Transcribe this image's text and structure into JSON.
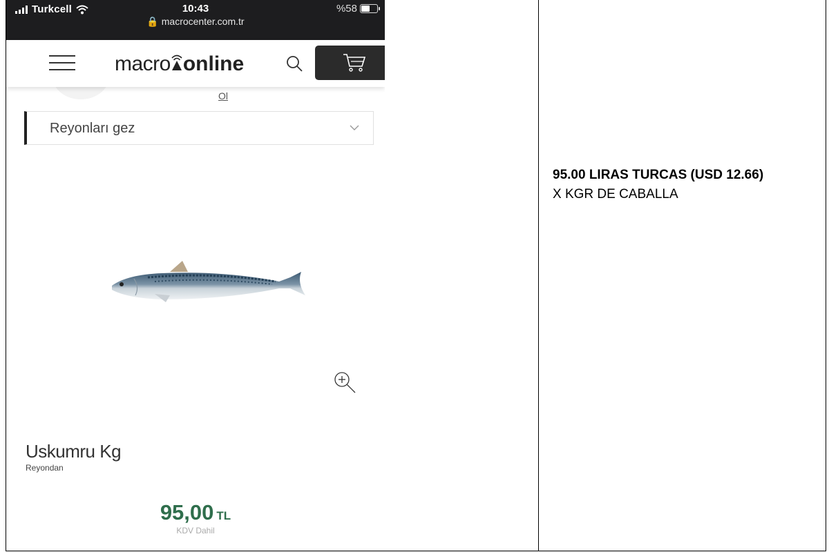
{
  "status_bar": {
    "carrier": "Turkcell",
    "time": "10:43",
    "url": "macrocenter.com.tr",
    "battery": "%58",
    "battery_level": 0.58
  },
  "header": {
    "logo_part1": "macro",
    "logo_part2": "online"
  },
  "partial_link": "Ol",
  "aisle_select": {
    "label": "Reyonları gez"
  },
  "product": {
    "name": "Uskumru Kg",
    "source": "Reyondan",
    "price": "95,00",
    "currency": "TL",
    "tax_note": "KDV Dahil"
  },
  "note": {
    "title": "95.00 LIRAS TURCAS (USD 12.66)",
    "subtitle": "X KGR DE CABALLA"
  },
  "colors": {
    "price_green": "#2f6e4c",
    "status_bar": "#1d1d1f",
    "cart_button": "#2b2b2b"
  }
}
